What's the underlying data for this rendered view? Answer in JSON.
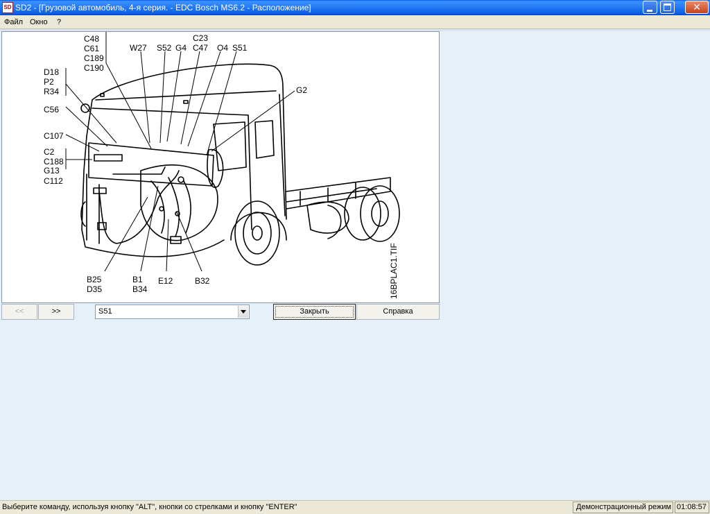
{
  "window": {
    "app_icon_text": "SD",
    "title": "SD2 - [Грузовой автомобиль, 4-я серия. - EDC Bosch MS6.2 - Расположение]"
  },
  "menu": {
    "items": [
      "Файл",
      "Окно",
      "?"
    ]
  },
  "diagram": {
    "callouts": [
      "C48",
      "C61",
      "C189",
      "C190",
      "W27",
      "S52",
      "G4",
      "C23",
      "C47",
      "O4",
      "S51",
      "D18",
      "P2",
      "R34",
      "G2",
      "C56",
      "C107",
      "C2",
      "C188",
      "G13",
      "C112",
      "B25",
      "D35",
      "B1",
      "B34",
      "E12",
      "B32"
    ],
    "image_id": "16BPLAC1.TIF"
  },
  "toolbar": {
    "prev_label": "<<",
    "next_label": ">>",
    "component_select": {
      "value": "S51"
    },
    "close_label": "Закрыть",
    "help_label": "Справка"
  },
  "status": {
    "hint": "Выберите команду, используя кнопку \"ALT\", кнопки со стрелками и кнопку \"ENTER\"",
    "mode": "Демонстрационный режим",
    "time": "01:08:57"
  },
  "colors": {
    "titlebar": "#2a7ef8",
    "workspace": "#e6f0f9",
    "chrome": "#ece9d8"
  },
  "icons": [
    "app-logo-icon",
    "minimize-icon",
    "maximize-icon",
    "close-icon",
    "chevron-down-icon"
  ]
}
